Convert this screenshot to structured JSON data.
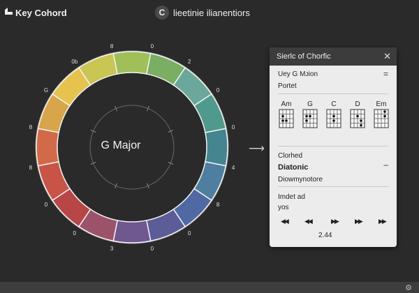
{
  "app": {
    "title": "Key Cohord",
    "center_badge": "C",
    "center_title": "lieetinie ilianentiors"
  },
  "wheel": {
    "key_label": "G Major",
    "segment_colors": [
      "#d9a54a",
      "#e6c24f",
      "#c9c653",
      "#9fbf59",
      "#7aae63",
      "#6ba79a",
      "#4f9a8c",
      "#44858f",
      "#4f7ea0",
      "#5069a2",
      "#5b5c98",
      "#6f5790",
      "#9c5369",
      "#b84647",
      "#c75447",
      "#d26a4a"
    ],
    "ring_labels": [
      "8",
      "G",
      "0b",
      "8",
      "0",
      "2",
      "0",
      "0",
      "4",
      "8",
      "0",
      "0",
      "3",
      "0",
      "0",
      "8"
    ]
  },
  "panel": {
    "title": "Sierlc of Chorfic",
    "section1_title": "Uey G Mᴊion",
    "section1_sub": "Portet",
    "chords": [
      {
        "name": "Am"
      },
      {
        "name": "G"
      },
      {
        "name": "C"
      },
      {
        "name": "D"
      },
      {
        "name": "Em"
      }
    ],
    "section2_label": "Clorhed",
    "section2_title": "Diatonic",
    "section2_sub": "Diowmynotore",
    "section3_label": "Imdet ad",
    "section3_sub": "yos",
    "time": "2.44",
    "dash1": "=",
    "dash2": "–"
  },
  "icons": {
    "logo": "logo-icon",
    "close": "close-icon",
    "arrow": "arrow-right-icon",
    "controls": [
      "rewind-icon",
      "step-back-icon",
      "play-icon",
      "step-forward-icon",
      "fast-forward-icon"
    ]
  },
  "glyphs": {
    "close": "✕",
    "arrow": "⟶",
    "bottom": "⚙"
  }
}
